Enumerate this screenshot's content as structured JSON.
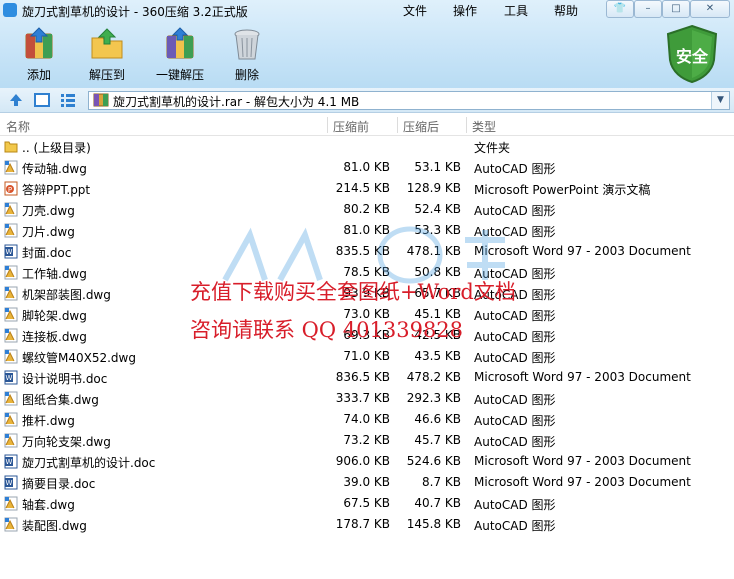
{
  "window": {
    "title": "旋刀式割草机的设计 - 360压缩 3.2正式版"
  },
  "menu": [
    {
      "label": "文件"
    },
    {
      "label": "操作"
    },
    {
      "label": "工具"
    },
    {
      "label": "帮助"
    }
  ],
  "toolbar": {
    "add_label": "添加",
    "extract_to_label": "解压到",
    "one_click_extract_label": "一键解压",
    "delete_label": "删除",
    "security_label": "安全"
  },
  "address": {
    "path": "旋刀式割草机的设计.rar - 解包大小为 4.1 MB"
  },
  "columns": {
    "name": "名称",
    "compressed": "压缩前",
    "uncompressed": "压缩后",
    "type": "类型"
  },
  "files": [
    {
      "name": ".. (上级目录)",
      "before": "",
      "after": "",
      "type": "文件夹",
      "icon": "folder"
    },
    {
      "name": "传动轴.dwg",
      "before": "81.0 KB",
      "after": "53.1 KB",
      "type": "AutoCAD 图形",
      "icon": "dwg"
    },
    {
      "name": "答辩PPT.ppt",
      "before": "214.5 KB",
      "after": "128.9 KB",
      "type": "Microsoft PowerPoint 演示文稿",
      "icon": "ppt"
    },
    {
      "name": "刀壳.dwg",
      "before": "80.2 KB",
      "after": "52.4 KB",
      "type": "AutoCAD 图形",
      "icon": "dwg"
    },
    {
      "name": "刀片.dwg",
      "before": "81.0 KB",
      "after": "53.3 KB",
      "type": "AutoCAD 图形",
      "icon": "dwg"
    },
    {
      "name": "封面.doc",
      "before": "835.5 KB",
      "after": "478.1 KB",
      "type": "Microsoft Word 97 - 2003 Document",
      "icon": "doc"
    },
    {
      "name": "工作轴.dwg",
      "before": "78.5 KB",
      "after": "50.8 KB",
      "type": "AutoCAD 图形",
      "icon": "dwg"
    },
    {
      "name": "机架部装图.dwg",
      "before": "93.9 KB",
      "after": "65.7 KB",
      "type": "AutoCAD 图形",
      "icon": "dwg"
    },
    {
      "name": "脚轮架.dwg",
      "before": "73.0 KB",
      "after": "45.1 KB",
      "type": "AutoCAD 图形",
      "icon": "dwg"
    },
    {
      "name": "连接板.dwg",
      "before": "69.3 KB",
      "after": "42.5 KB",
      "type": "AutoCAD 图形",
      "icon": "dwg"
    },
    {
      "name": "螺纹管M40X52.dwg",
      "before": "71.0 KB",
      "after": "43.5 KB",
      "type": "AutoCAD 图形",
      "icon": "dwg"
    },
    {
      "name": "设计说明书.doc",
      "before": "836.5 KB",
      "after": "478.2 KB",
      "type": "Microsoft Word 97 - 2003 Document",
      "icon": "doc"
    },
    {
      "name": "图纸合集.dwg",
      "before": "333.7 KB",
      "after": "292.3 KB",
      "type": "AutoCAD 图形",
      "icon": "dwg"
    },
    {
      "name": "推杆.dwg",
      "before": "74.0 KB",
      "after": "46.6 KB",
      "type": "AutoCAD 图形",
      "icon": "dwg"
    },
    {
      "name": "万向轮支架.dwg",
      "before": "73.2 KB",
      "after": "45.7 KB",
      "type": "AutoCAD 图形",
      "icon": "dwg"
    },
    {
      "name": "旋刀式割草机的设计.doc",
      "before": "906.0 KB",
      "after": "524.6 KB",
      "type": "Microsoft Word 97 - 2003 Document",
      "icon": "doc"
    },
    {
      "name": "摘要目录.doc",
      "before": "39.0 KB",
      "after": "8.7 KB",
      "type": "Microsoft Word 97 - 2003 Document",
      "icon": "doc"
    },
    {
      "name": "轴套.dwg",
      "before": "67.5 KB",
      "after": "40.7 KB",
      "type": "AutoCAD 图形",
      "icon": "dwg"
    },
    {
      "name": "装配图.dwg",
      "before": "178.7 KB",
      "after": "145.8 KB",
      "type": "AutoCAD 图形",
      "icon": "dwg"
    }
  ],
  "watermark": {
    "line1": "充值下载购买全套图纸+Word文档",
    "line2": "咨询请联系  QQ 401339828"
  },
  "colors": {
    "watermark": "#d81e2a",
    "shield": "#3f9b3a",
    "titlebar": "#c6e3f7"
  }
}
